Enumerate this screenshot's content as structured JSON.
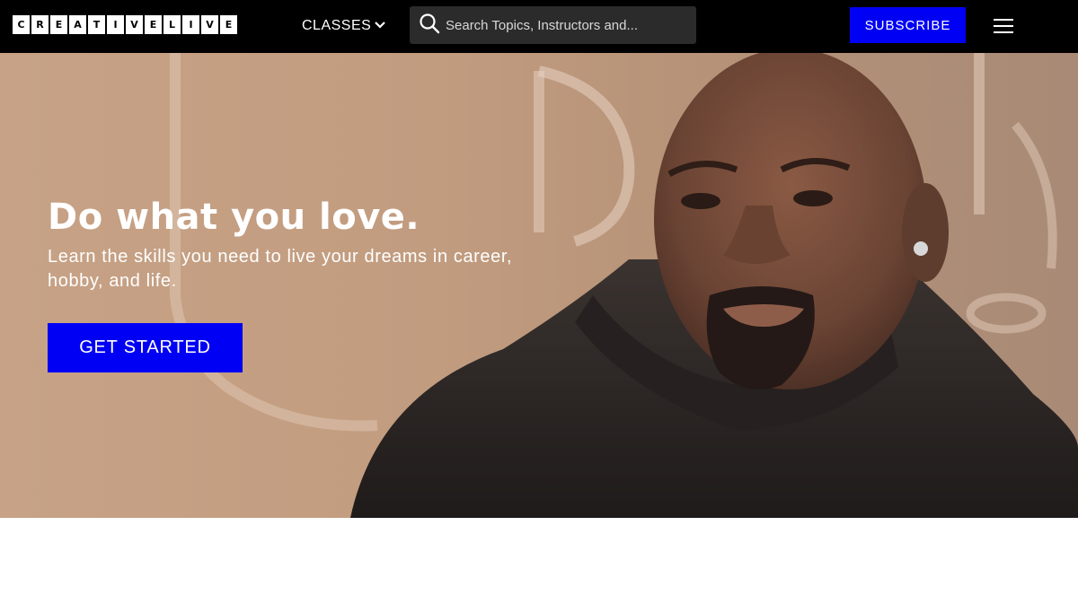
{
  "header": {
    "logo_letters": [
      "C",
      "R",
      "E",
      "A",
      "T",
      "I",
      "V",
      "E",
      "L",
      "I",
      "V",
      "E"
    ],
    "classes_label": "CLASSES",
    "search_placeholder": "Search Topics, Instructors and...",
    "subscribe_label": "SUBSCRIBE",
    "icons": {
      "search": "search-icon",
      "classes_caret": "chevron-down-icon",
      "menu": "hamburger-menu-icon"
    }
  },
  "hero": {
    "headline": "Do what you love.",
    "subheadline": "Learn the skills you need to live your dreams in career, hobby, and life.",
    "cta_label": "GET STARTED"
  },
  "colors": {
    "nav_background": "#000000",
    "accent_blue": "#0000f5",
    "search_background": "#2b2b2b",
    "hero_text": "#ffffff"
  }
}
